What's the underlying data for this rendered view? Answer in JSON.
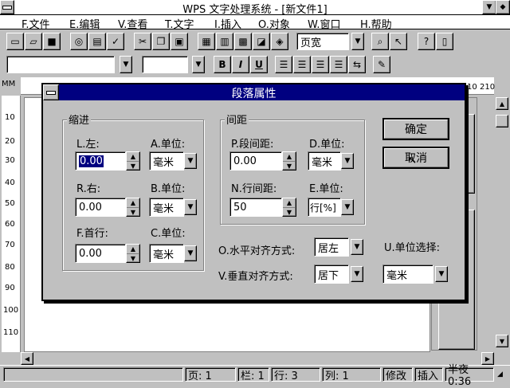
{
  "window": {
    "title": "WPS 文字处理系统 - [新文件1]"
  },
  "menu": [
    {
      "key": "F",
      "label": "F.文件"
    },
    {
      "key": "E",
      "label": "E.编辑"
    },
    {
      "key": "V",
      "label": "V.查看"
    },
    {
      "key": "T",
      "label": "T.文字"
    },
    {
      "key": "I",
      "label": "I.插入"
    },
    {
      "key": "O",
      "label": "O.对象"
    },
    {
      "key": "W",
      "label": "W.窗口"
    },
    {
      "key": "H",
      "label": "H.帮助"
    }
  ],
  "toolbar": {
    "view_combo": "页宽",
    "font_combo": "",
    "size_combo": "",
    "bold": "B",
    "italic": "I",
    "underline": "U"
  },
  "ruler": {
    "unit": "MM",
    "right_ticks": [
      "10",
      "210"
    ],
    "left_ticks": [
      "10",
      "20",
      "30",
      "40",
      "50",
      "60",
      "70",
      "80",
      "90",
      "100",
      "110"
    ]
  },
  "dialog": {
    "title": "段落属性",
    "indent": {
      "heading": "缩进",
      "left_label": "L.左:",
      "left_value": "0.00",
      "left_unit_label": "A.单位:",
      "left_unit": "毫米",
      "right_label": "R.右:",
      "right_value": "0.00",
      "right_unit_label": "B.单位:",
      "right_unit": "毫米",
      "first_label": "F.首行:",
      "first_value": "0.00",
      "first_unit_label": "C.单位:",
      "first_unit": "毫米"
    },
    "spacing": {
      "heading": "间距",
      "para_label": "P.段间距:",
      "para_value": "0.00",
      "para_unit_label": "D.单位:",
      "para_unit": "毫米",
      "line_label": "N.行间距:",
      "line_value": "50",
      "line_unit_label": "E.单位:",
      "line_unit": "行[%]"
    },
    "halign_label": "O.水平对齐方式:",
    "halign_value": "居左",
    "valign_label": "V.垂直对齐方式:",
    "valign_value": "居下",
    "unit_select_label": "U.单位选择:",
    "unit_select_value": "毫米",
    "ok": "确定",
    "cancel": "取消"
  },
  "status": {
    "page": "页: 1",
    "column": "栏: 1",
    "row": "行: 3",
    "col": "列: 1",
    "mode": "修改",
    "insert": "插入",
    "time": "半夜0:36"
  }
}
